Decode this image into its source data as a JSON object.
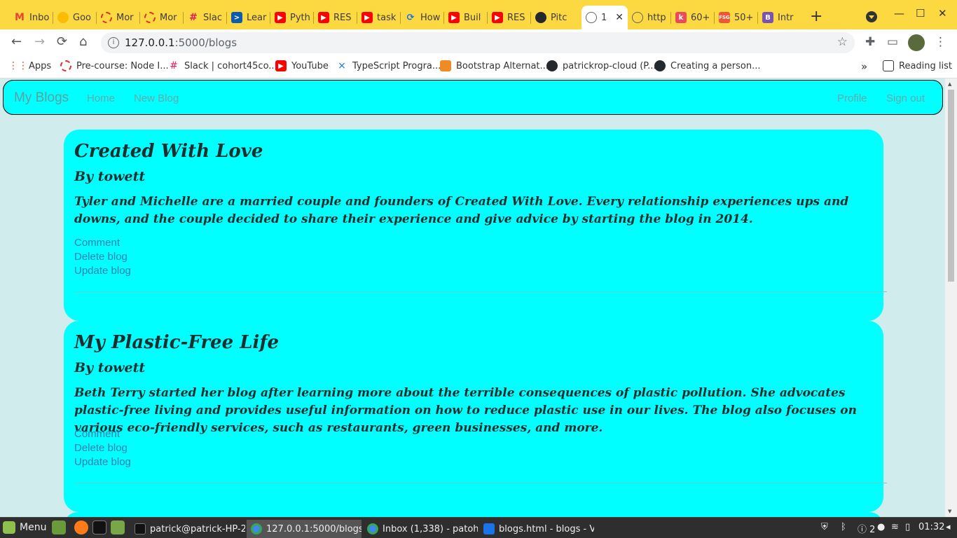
{
  "browser": {
    "tabs": [
      {
        "label": "Inbo",
        "icon": "gmail-icon",
        "color": "#ea4335"
      },
      {
        "label": "Goo",
        "icon": "google-keep-icon",
        "color": "#fbbc04"
      },
      {
        "label": "Mor",
        "icon": "ring-icon",
        "color": "#d93025"
      },
      {
        "label": "Mor",
        "icon": "ring-icon",
        "color": "#d93025"
      },
      {
        "label": "Slac",
        "icon": "slack-icon",
        "color": "#611f69"
      },
      {
        "label": "Lear",
        "icon": "terminal-icon",
        "color": "#0b5cad"
      },
      {
        "label": "Pyth",
        "icon": "youtube-icon",
        "color": "#ff0000"
      },
      {
        "label": "RES",
        "icon": "youtube-icon",
        "color": "#ff0000"
      },
      {
        "label": "task",
        "icon": "youtube-icon",
        "color": "#ff0000"
      },
      {
        "label": "How",
        "icon": "refresh-icon",
        "color": "#1a73e8"
      },
      {
        "label": "Buil",
        "icon": "youtube-icon",
        "color": "#ff0000"
      },
      {
        "label": "RES",
        "icon": "youtube-icon",
        "color": "#ff0000"
      },
      {
        "label": "Pitc",
        "icon": "github-icon",
        "color": "#24292e"
      },
      {
        "label": "1",
        "icon": "globe-icon",
        "color": "#5f6368",
        "active": true
      },
      {
        "label": "http",
        "icon": "globe-icon",
        "color": "#5f6368"
      },
      {
        "label": "60+",
        "icon": "k-icon",
        "color": "#e94b5b"
      },
      {
        "label": "50+",
        "icon": "fsg-icon",
        "color": "#f05537"
      },
      {
        "label": "Intr",
        "icon": "bootstrap-icon",
        "color": "#7952b3"
      }
    ],
    "url_host": "127.0.0.1",
    "url_path": ":5000/blogs"
  },
  "bookmarks": {
    "items": [
      {
        "label": "Apps",
        "icon": "apps-grid-icon"
      },
      {
        "label": "Pre-course: Node I...",
        "icon": "ring-icon"
      },
      {
        "label": "Slack | cohort45co...",
        "icon": "slack-icon"
      },
      {
        "label": "YouTube",
        "icon": "youtube-icon"
      },
      {
        "label": "TypeScript Progra...",
        "icon": "vscode-icon"
      },
      {
        "label": "Bootstrap Alternat...",
        "icon": "fox-icon"
      },
      {
        "label": "patrickrop-cloud (P...",
        "icon": "github-icon"
      },
      {
        "label": "Creating a person...",
        "icon": "github-icon"
      }
    ],
    "more": "»",
    "reading_list": "Reading list"
  },
  "app": {
    "brand": "My Blogs",
    "nav_left": [
      "Home",
      "New Blog"
    ],
    "nav_right": [
      "Profile",
      "Sign out"
    ]
  },
  "blogs": [
    {
      "title": "Created With Love",
      "author": "By towett",
      "body": "Tyler and Michelle are a married couple and founders of Created With Love. Every relationship experiences ups and downs, and the couple decided to share their experience and give advice by starting the blog in 2014.",
      "actions": [
        "Comment",
        "Delete blog",
        "Update blog"
      ]
    },
    {
      "title": "My Plastic-Free Life",
      "author": "By towett",
      "body": "Beth Terry started her blog after learning more about the terrible consequences of plastic pollution. She advocates plastic-free living and provides useful information on how to reduce plastic use in our lives. The blog also focuses on various eco-friendly services, such as restaurants, green businesses, and more.",
      "actions": [
        "Comment",
        "Delete blog",
        "Update blog"
      ]
    }
  ],
  "taskbar": {
    "menu": "Menu",
    "tasks": [
      "patrick@patrick-HP-2...",
      "127.0.0.1:5000/blogs ...",
      "Inbox (1,338) - patoh...",
      "blogs.html - blogs - Vi..."
    ],
    "notifications": "2",
    "clock": "01:32"
  },
  "colors": {
    "tab_bar": "#fcd841",
    "accent": "#00ffff",
    "page_bg": "#d1ecec",
    "link": "#2e7fb0"
  }
}
